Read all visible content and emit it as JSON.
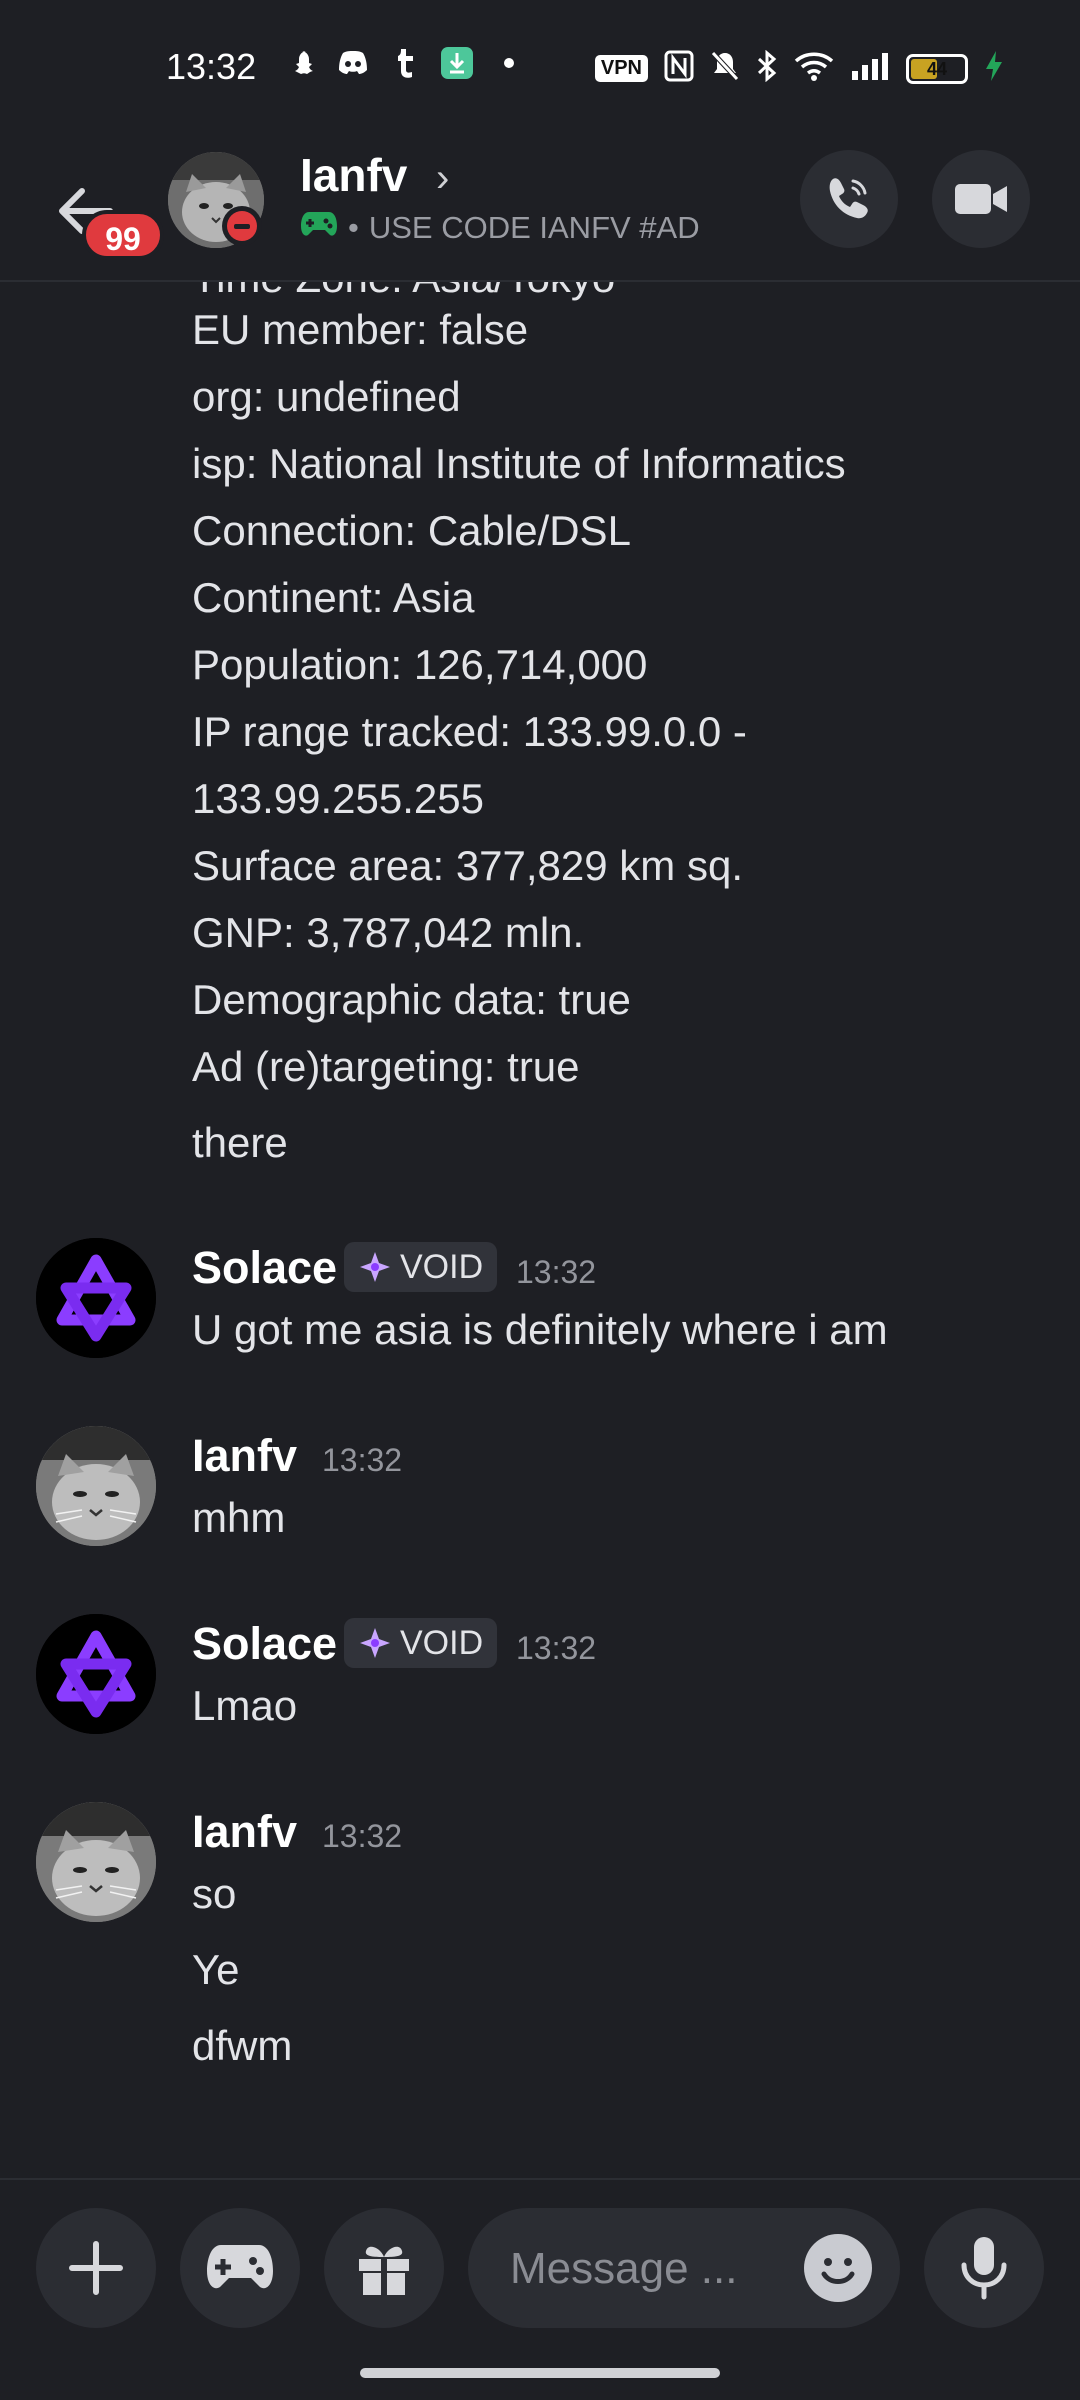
{
  "status_bar": {
    "time": "13:32",
    "vpn_label": "VPN",
    "battery": "44"
  },
  "header": {
    "unread_count": "99",
    "name": "Ianfv",
    "chevron": "›",
    "status_separator": "•",
    "status_text": "USE CODE IANFV #AD"
  },
  "messages": {
    "partial_top": "Time Zone: Asia/Tokyo",
    "ip_lines": [
      "EU member: false",
      "org: undefined",
      "isp: National Institute of Informatics",
      "Connection: Cable/DSL",
      "Continent: Asia",
      "Population: 126,714,000",
      "IP range tracked: 133.99.0.0 -",
      "133.99.255.255",
      "Surface area: 377,829 km sq.",
      "GNP: 3,787,042 mln.",
      "Demographic data: true",
      "Ad (re)targeting: true"
    ],
    "there": "there",
    "groups": [
      {
        "author": "Solace",
        "tag": "VOID",
        "time": "13:32",
        "lines": [
          "U got me asia is definitely where i am"
        ]
      },
      {
        "author": "Ianfv",
        "time": "13:32",
        "lines": [
          "mhm"
        ]
      },
      {
        "author": "Solace",
        "tag": "VOID",
        "time": "13:32",
        "lines": [
          "Lmao"
        ]
      },
      {
        "author": "Ianfv",
        "time": "13:32",
        "lines": [
          "so",
          "Ye",
          "dfwm"
        ]
      }
    ]
  },
  "composer": {
    "placeholder": "Message ..."
  },
  "colors": {
    "background": "#1e1f24",
    "accent_purple": "#8b3dff",
    "dnd_red": "#e03a3e",
    "game_green": "#23a559"
  }
}
